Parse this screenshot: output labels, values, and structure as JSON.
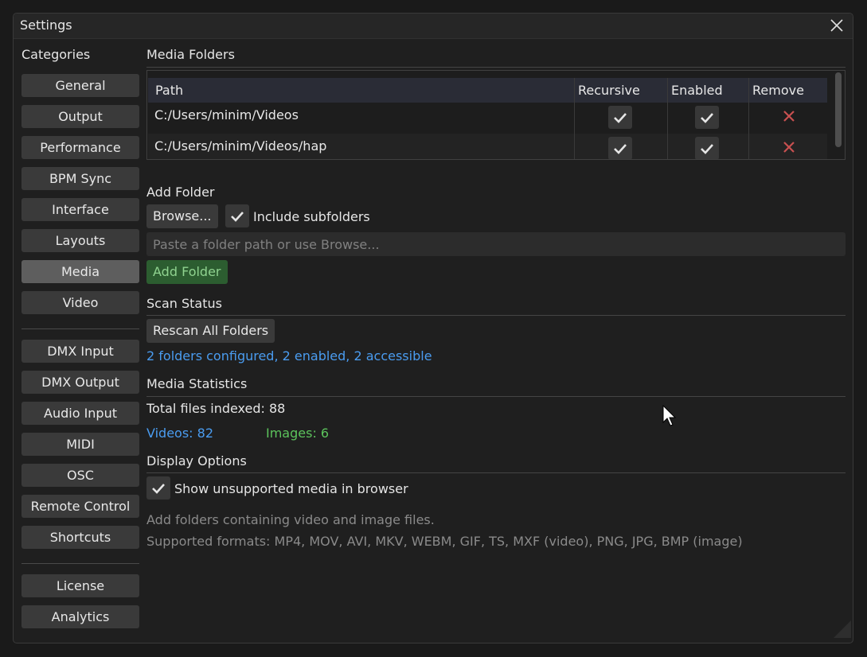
{
  "window": {
    "title": "Settings"
  },
  "sidebar": {
    "heading": "Categories",
    "groups": [
      [
        "General",
        "Output",
        "Performance",
        "BPM Sync",
        "Interface",
        "Layouts",
        "Media",
        "Video"
      ],
      [
        "DMX Input",
        "DMX Output",
        "Audio Input",
        "MIDI",
        "OSC",
        "Remote Control",
        "Shortcuts"
      ],
      [
        "License",
        "Analytics"
      ]
    ],
    "active": "Media"
  },
  "media_folders": {
    "title": "Media Folders",
    "columns": {
      "path": "Path",
      "recursive": "Recursive",
      "enabled": "Enabled",
      "remove": "Remove"
    },
    "rows": [
      {
        "path": "C:/Users/minim/Videos",
        "recursive": true,
        "enabled": true
      },
      {
        "path": "C:/Users/minim/Videos/hap",
        "recursive": true,
        "enabled": true
      }
    ]
  },
  "add_folder": {
    "title": "Add Folder",
    "browse_label": "Browse...",
    "include_subfolders_label": "Include subfolders",
    "include_subfolders_checked": true,
    "path_value": "",
    "path_placeholder": "Paste a folder path or use Browse...",
    "add_label": "Add Folder"
  },
  "scan_status": {
    "title": "Scan Status",
    "rescan_label": "Rescan All Folders",
    "summary": "2 folders configured, 2 enabled, 2 accessible"
  },
  "media_statistics": {
    "title": "Media Statistics",
    "total": "Total files indexed: 88",
    "videos": "Videos: 82",
    "images": "Images: 6"
  },
  "display_options": {
    "title": "Display Options",
    "show_unsupported_label": "Show unsupported media in browser",
    "show_unsupported_checked": true,
    "help_line_1": "Add folders containing video and image files.",
    "help_line_2": "Supported formats: MP4, MOV, AVI, MKV, WEBM, GIF, TS, MXF (video), PNG, JPG, BMP (image)"
  },
  "colors": {
    "accent_blue": "#4a9cf0",
    "accent_green": "#5cc35c",
    "remove_red": "#c85050",
    "active_item": "#5e5e5e"
  }
}
